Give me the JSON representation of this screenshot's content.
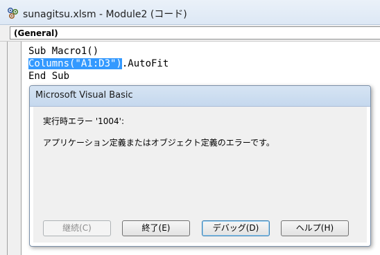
{
  "window": {
    "title": "sunagitsu.xlsm - Module2 (コード)",
    "icon": "vba-module-icon"
  },
  "procedure_bar": {
    "object_value": "(General)"
  },
  "code": {
    "line1": "Sub Macro1()",
    "line2_selected": "Columns(\"A1:D3\")",
    "line2_rest": ".AutoFit",
    "line3": "End Sub"
  },
  "dialog": {
    "title": "Microsoft Visual Basic",
    "error_number_text": "実行時エラー '1004':",
    "error_message": "アプリケーション定義またはオブジェクト定義のエラーです。",
    "buttons": {
      "continue": "継続(C)",
      "end": "終了(E)",
      "debug": "デバッグ(D)",
      "help": "ヘルプ(H)"
    }
  },
  "colors": {
    "selection": "#3399ff",
    "title_gradient_top": "#eaf1f9",
    "dialog_caption": "#c5d8ee"
  }
}
